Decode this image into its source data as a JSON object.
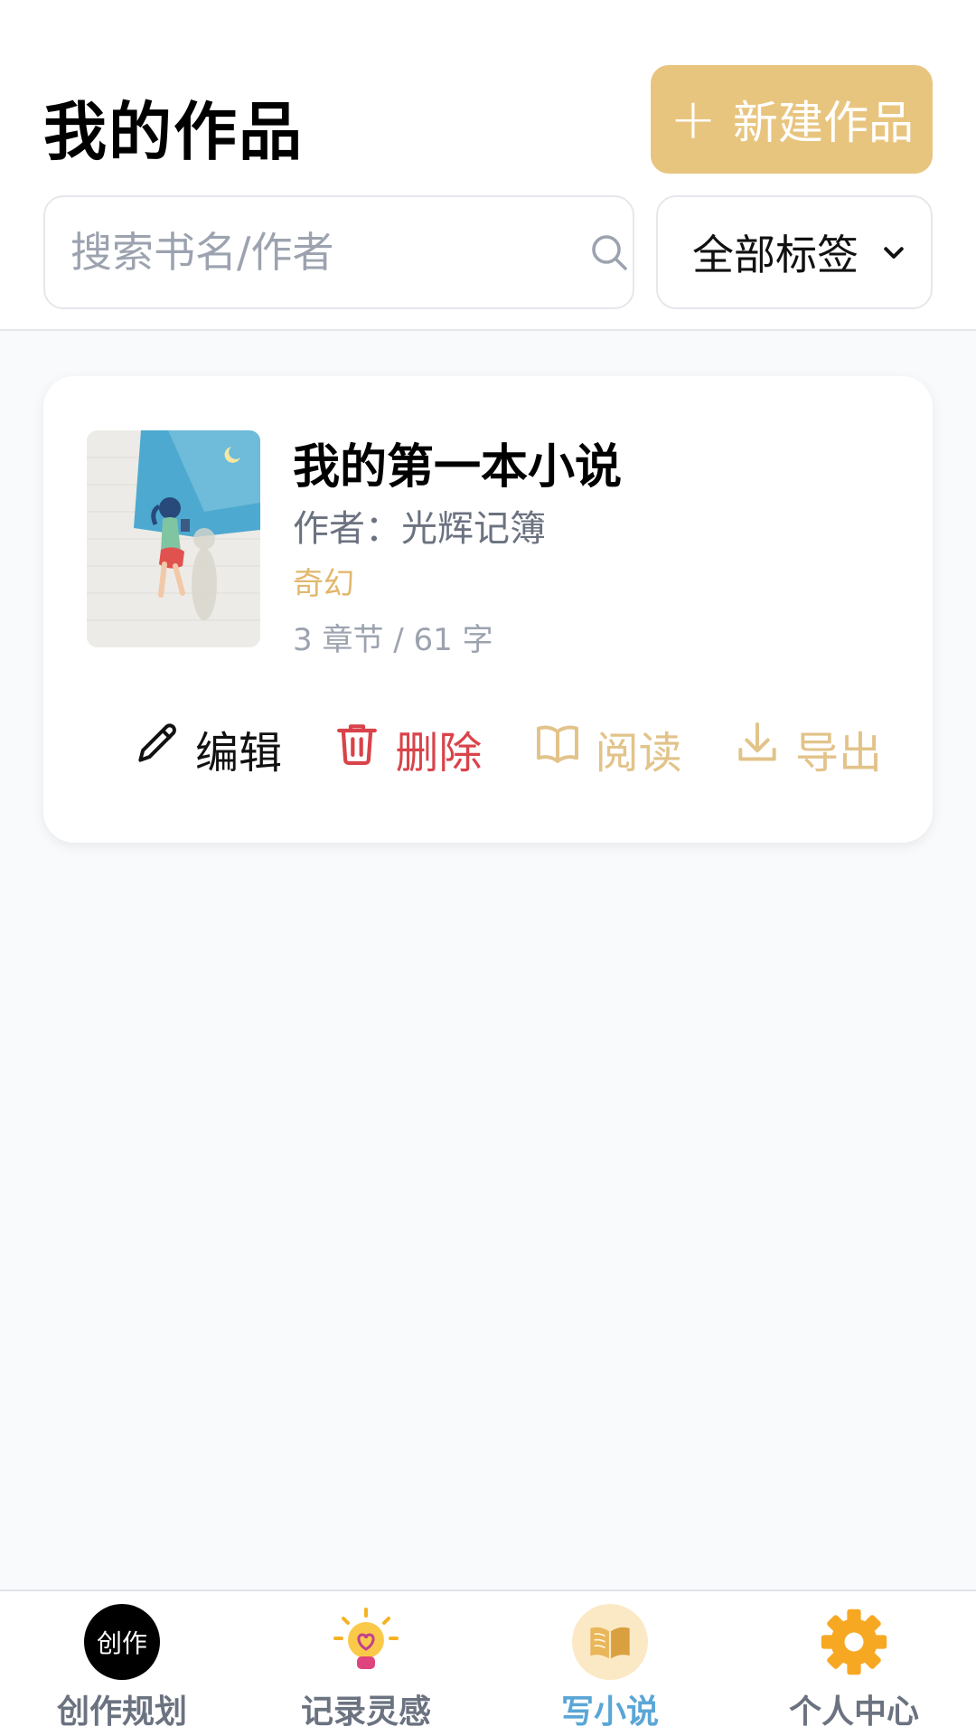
{
  "header": {
    "title": "我的作品",
    "new_button_label": "新建作品",
    "search_placeholder": "搜索书名/作者",
    "tag_filter_value": "全部标签"
  },
  "works": [
    {
      "title": "我的第一本小说",
      "author": "作者：光辉记簿",
      "genre": "奇幻",
      "stats": "3 章节 / 61 字"
    }
  ],
  "card_actions": {
    "edit": "编辑",
    "delete": "删除",
    "read": "阅读",
    "export": "导出"
  },
  "bottom_nav": {
    "items": [
      {
        "label": "创作规划",
        "icon": "create-badge-icon",
        "badge_text": "创作"
      },
      {
        "label": "记录灵感",
        "icon": "lightbulb-icon"
      },
      {
        "label": "写小说",
        "icon": "open-book-icon",
        "active": true
      },
      {
        "label": "个人中心",
        "icon": "gear-icon"
      }
    ]
  },
  "colors": {
    "accent": "#e8c57f",
    "delete": "#d9434a",
    "active_nav": "#5aa6d6",
    "background": "#f8fafc"
  }
}
